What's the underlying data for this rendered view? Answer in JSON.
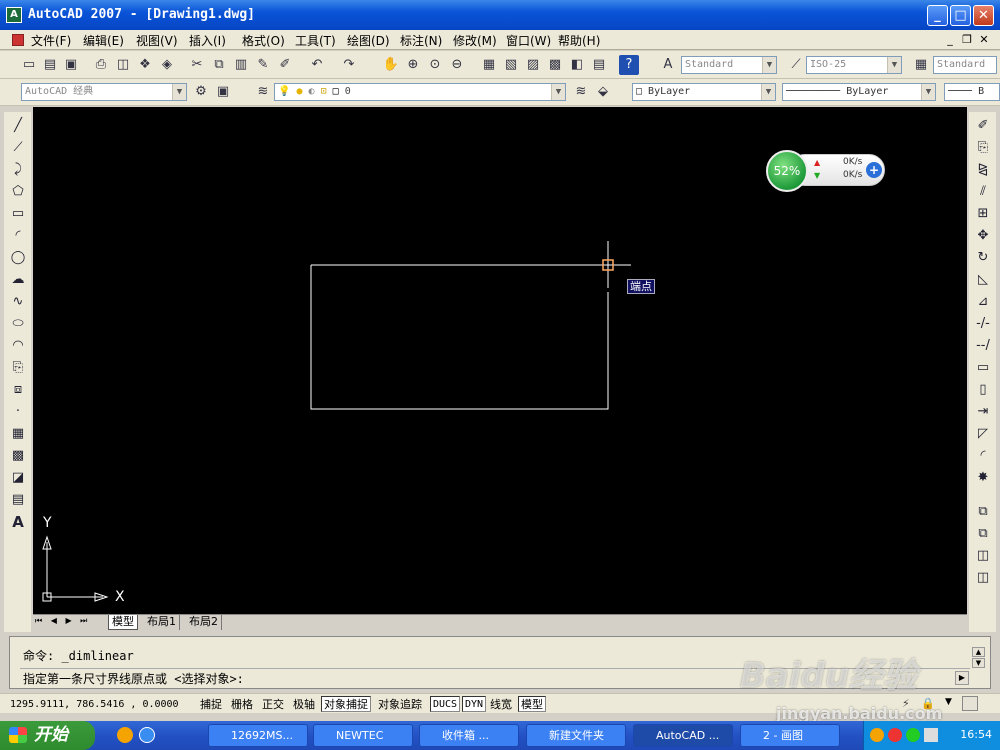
{
  "window": {
    "app_icon_text": "A",
    "title": "AutoCAD 2007 - [Drawing1.dwg]",
    "minimize": "_",
    "maximize": "□",
    "close": "✕"
  },
  "menu": {
    "items": [
      "文件(F)",
      "编辑(E)",
      "视图(V)",
      "插入(I)",
      "格式(O)",
      "工具(T)",
      "绘图(D)",
      "标注(N)",
      "修改(M)",
      "窗口(W)",
      "帮助(H)"
    ],
    "mdi_min": "_",
    "mdi_restore": "❐",
    "mdi_close": "✕"
  },
  "toolbar1": {
    "text_style": "Standard",
    "dim_style": "ISO-25",
    "table_style": "Standard"
  },
  "toolbar2": {
    "workspace": "AutoCAD 经典",
    "layer": "0",
    "color": "ByLayer",
    "linetype": "ByLayer",
    "lineweight": "B"
  },
  "drawing": {
    "osnap_tooltip": "端点",
    "ucs_y_label": "Y",
    "ucs_x_label": "X"
  },
  "net_widget": {
    "percent": "52%",
    "up_speed": "0K/s",
    "down_speed": "0K/s"
  },
  "tabs": {
    "nav": [
      "⏮",
      "◀",
      "▶",
      "⏭"
    ],
    "items": [
      "模型",
      "布局1",
      "布局2"
    ]
  },
  "command": {
    "line1": "命令:  _dimlinear",
    "line2": "指定第一条尺寸界线原点或 <选择对象>:"
  },
  "status": {
    "coords": "1295.9111, 786.5416 , 0.0000",
    "buttons": [
      "捕捉",
      "栅格",
      "正交",
      "极轴",
      "对象捕捉",
      "对象追踪",
      "DUCS",
      "DYN",
      "线宽",
      "模型"
    ]
  },
  "taskbar": {
    "start_label": "开始",
    "tasks": [
      "12692MS...",
      "NEWTEC",
      "收件箱 ...",
      "新建文件夹",
      "AutoCAD ...",
      "2 - 画图"
    ],
    "clock": "16:54"
  },
  "watermark": {
    "text": "Baidu经验",
    "url": "jingyan.baidu.com"
  }
}
